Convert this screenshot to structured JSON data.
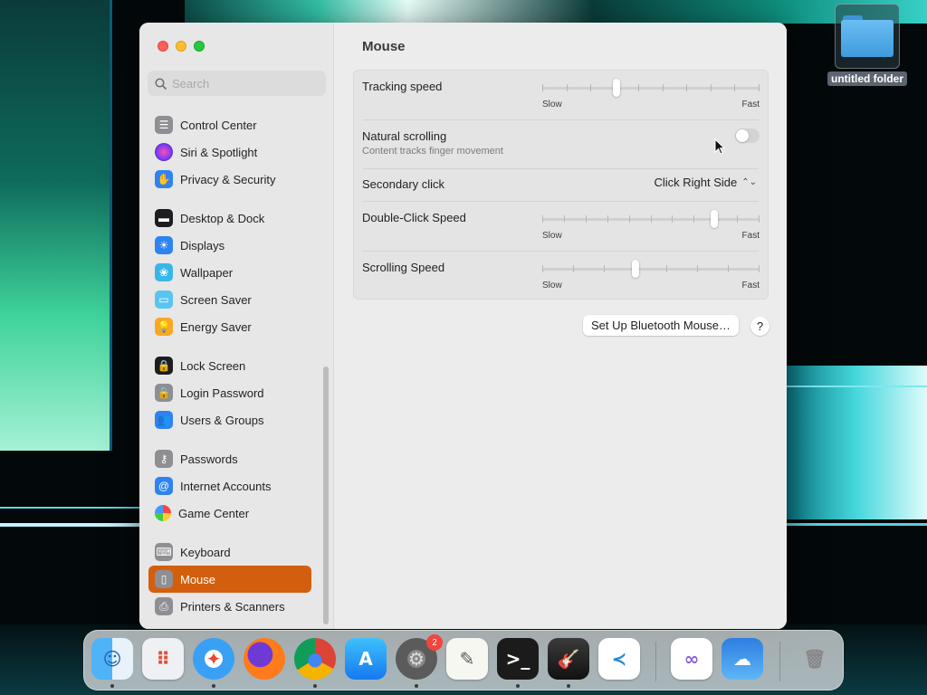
{
  "desktop": {
    "folder_label": "untitled folder"
  },
  "window": {
    "title": "Mouse",
    "search": {
      "placeholder": "Search",
      "value": ""
    },
    "sidebar": {
      "items": [
        {
          "label": "Control Center",
          "icon": "control-center-icon",
          "color": "#8e8e93"
        },
        {
          "label": "Siri & Spotlight",
          "icon": "siri-icon",
          "color": "#6a3bd1"
        },
        {
          "label": "Privacy & Security",
          "icon": "hand-icon",
          "color": "#2f83f0"
        },
        {
          "label": "Desktop & Dock",
          "icon": "dock-icon",
          "color": "#1d1d1f"
        },
        {
          "label": "Displays",
          "icon": "sun-icon",
          "color": "#2f83f0"
        },
        {
          "label": "Wallpaper",
          "icon": "wallpaper-icon",
          "color": "#38b6e8"
        },
        {
          "label": "Screen Saver",
          "icon": "screen-saver-icon",
          "color": "#5ac4f0"
        },
        {
          "label": "Energy Saver",
          "icon": "lightbulb-icon",
          "color": "#f7a823"
        },
        {
          "label": "Lock Screen",
          "icon": "lock-icon",
          "color": "#1d1d1f"
        },
        {
          "label": "Login Password",
          "icon": "padlock-icon",
          "color": "#8e8e93"
        },
        {
          "label": "Users & Groups",
          "icon": "users-icon",
          "color": "#2f83f0"
        },
        {
          "label": "Passwords",
          "icon": "key-icon",
          "color": "#8e8e93"
        },
        {
          "label": "Internet Accounts",
          "icon": "at-icon",
          "color": "#2f83f0"
        },
        {
          "label": "Game Center",
          "icon": "game-center-icon",
          "color": "#ffffff"
        },
        {
          "label": "Keyboard",
          "icon": "keyboard-icon",
          "color": "#8e8e93"
        },
        {
          "label": "Mouse",
          "icon": "mouse-icon",
          "color": "#8e8e93",
          "selected": true
        },
        {
          "label": "Printers & Scanners",
          "icon": "printer-icon",
          "color": "#8e8e93"
        }
      ]
    },
    "settings": {
      "tracking_speed": {
        "label": "Tracking speed",
        "min_label": "Slow",
        "max_label": "Fast",
        "value": 0.34,
        "ticks": 10
      },
      "natural_scrolling": {
        "label": "Natural scrolling",
        "description": "Content tracks finger movement",
        "enabled": false
      },
      "secondary_click": {
        "label": "Secondary click",
        "value": "Click Right Side"
      },
      "double_click_speed": {
        "label": "Double-Click Speed",
        "min_label": "Slow",
        "max_label": "Fast",
        "value": 0.79,
        "ticks": 11
      },
      "scrolling_speed": {
        "label": "Scrolling Speed",
        "min_label": "Slow",
        "max_label": "Fast",
        "value": 0.43,
        "ticks": 8
      }
    },
    "buttons": {
      "bluetooth": "Set Up Bluetooth Mouse…",
      "help": "?"
    }
  },
  "dock": {
    "apps": [
      {
        "name": "Finder",
        "icon": "finder-icon",
        "running": true
      },
      {
        "name": "Launchpad",
        "icon": "launchpad-icon",
        "running": false
      },
      {
        "name": "Safari",
        "icon": "safari-icon",
        "running": true
      },
      {
        "name": "Firefox",
        "icon": "firefox-icon",
        "running": false
      },
      {
        "name": "Chrome",
        "icon": "chrome-icon",
        "running": true
      },
      {
        "name": "App Store",
        "icon": "app-store-icon",
        "running": false
      },
      {
        "name": "System Settings",
        "icon": "system-settings-icon",
        "running": true,
        "badge": "2"
      },
      {
        "name": "TextEdit",
        "icon": "textedit-icon",
        "running": false
      },
      {
        "name": "Terminal",
        "icon": "terminal-icon",
        "running": true
      },
      {
        "name": "GarageBand",
        "icon": "garageband-icon",
        "running": true
      },
      {
        "name": "Visual Studio Code",
        "icon": "vscode-icon",
        "running": false
      },
      {
        "name": "Visual Studio",
        "icon": "visual-studio-icon",
        "running": false
      },
      {
        "name": "Weather",
        "icon": "weather-icon",
        "running": false
      },
      {
        "name": "Trash",
        "icon": "trash-icon",
        "running": false
      }
    ]
  }
}
